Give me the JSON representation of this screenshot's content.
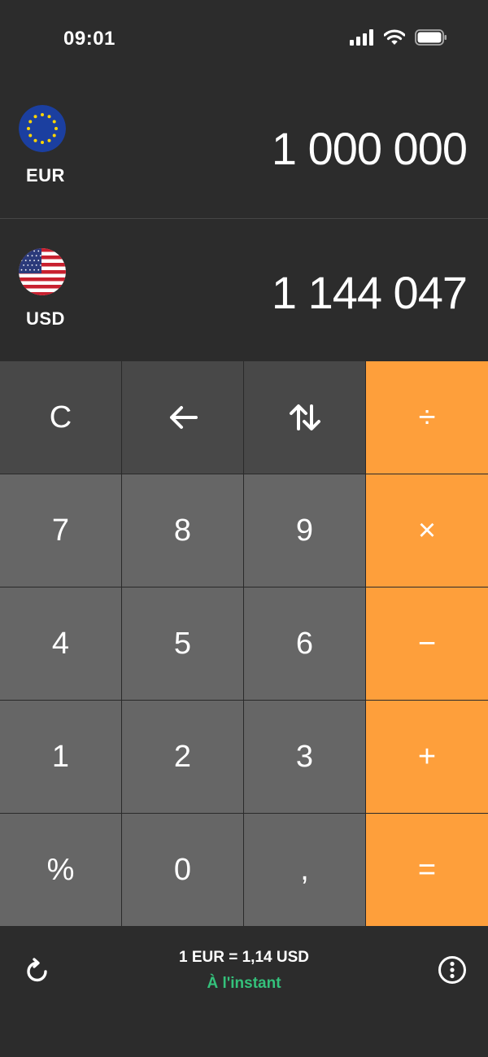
{
  "status_bar": {
    "time": "09:01",
    "icons": [
      "signal-icon",
      "wifi-icon",
      "battery-icon"
    ]
  },
  "currencies": [
    {
      "code": "EUR",
      "amount": "1 000 000",
      "flag": "eu-flag-icon"
    },
    {
      "code": "USD",
      "amount": "1 144 047",
      "flag": "us-flag-icon"
    }
  ],
  "keypad": {
    "rows": [
      [
        {
          "label": "C",
          "name": "clear-button"
        },
        {
          "label": "←",
          "name": "backspace-button"
        },
        {
          "label": "⇅",
          "name": "swap-button"
        },
        {
          "label": "÷",
          "name": "divide-button"
        }
      ],
      [
        {
          "label": "7",
          "name": "key-7"
        },
        {
          "label": "8",
          "name": "key-8"
        },
        {
          "label": "9",
          "name": "key-9"
        },
        {
          "label": "×",
          "name": "multiply-button"
        }
      ],
      [
        {
          "label": "4",
          "name": "key-4"
        },
        {
          "label": "5",
          "name": "key-5"
        },
        {
          "label": "6",
          "name": "key-6"
        },
        {
          "label": "−",
          "name": "subtract-button"
        }
      ],
      [
        {
          "label": "1",
          "name": "key-1"
        },
        {
          "label": "2",
          "name": "key-2"
        },
        {
          "label": "3",
          "name": "key-3"
        },
        {
          "label": "+",
          "name": "add-button"
        }
      ],
      [
        {
          "label": "%",
          "name": "percent-button"
        },
        {
          "label": "0",
          "name": "key-0"
        },
        {
          "label": ",",
          "name": "decimal-button"
        },
        {
          "label": "=",
          "name": "equals-button"
        }
      ]
    ]
  },
  "footer": {
    "rate": "1 EUR = 1,14 USD",
    "updated": "À l'instant",
    "refresh_icon": "refresh-icon",
    "more_icon": "more-icon"
  },
  "colors": {
    "background": "#2c2c2c",
    "key_top": "#484848",
    "key_number": "#666666",
    "key_operator": "#fe9f3b",
    "updated_text": "#34c17b"
  }
}
